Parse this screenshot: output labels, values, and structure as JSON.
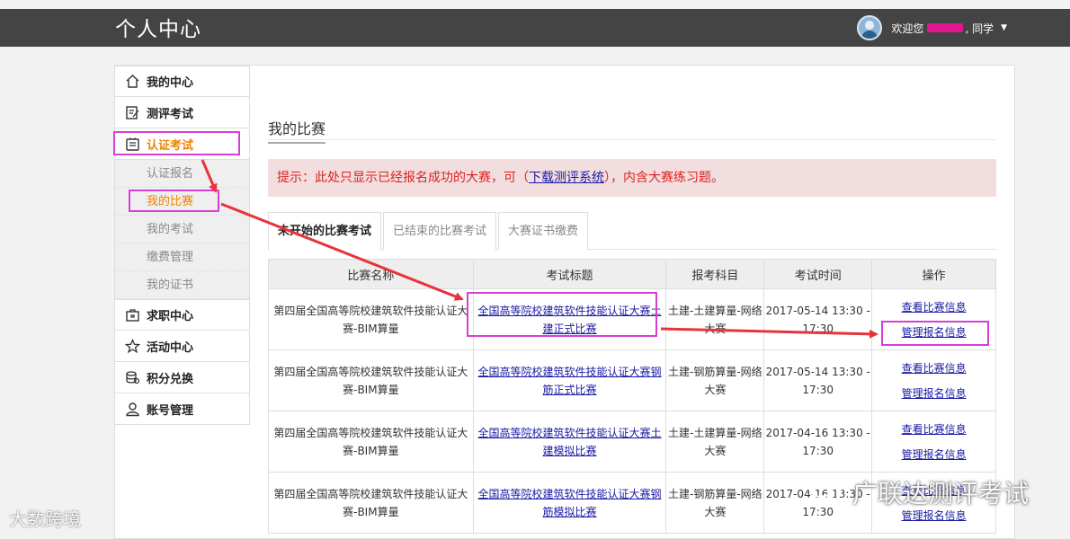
{
  "header": {
    "app_title": "个人中心",
    "welcome_prefix": "欢迎您",
    "welcome_suffix": ", 同学"
  },
  "sidebar": {
    "items": [
      {
        "label": "我的中心",
        "icon": "home-icon"
      },
      {
        "label": "测评考试",
        "icon": "document-edit-icon"
      },
      {
        "label": "认证考试",
        "icon": "certificate-icon"
      },
      {
        "label": "求职中心",
        "icon": "briefcase-icon"
      },
      {
        "label": "活动中心",
        "icon": "star-icon"
      },
      {
        "label": "积分兑换",
        "icon": "coins-icon"
      },
      {
        "label": "账号管理",
        "icon": "user-icon"
      }
    ],
    "sub_items": [
      "认证报名",
      "我的比赛",
      "我的考试",
      "缴费管理",
      "我的证书"
    ]
  },
  "main": {
    "section_title": "我的比赛",
    "notice_prefix": "提示：此处只显示已经报名成功的大赛，可（",
    "notice_link": "下载测评系统",
    "notice_suffix": "），内含大赛练习题。",
    "tabs": [
      "未开始的比赛考试",
      "已结束的比赛考试",
      "大赛证书缴费"
    ],
    "table": {
      "headers": [
        "比赛名称",
        "考试标题",
        "报考科目",
        "考试时间",
        "操作"
      ],
      "rows": [
        {
          "name": "第四届全国高等院校建筑软件技能认证大赛-BIM算量",
          "title": "全国高等院校建筑软件技能认证大赛土建正式比赛",
          "subject": "土建-土建算量-网络大赛",
          "time": "2017-05-14 13:30 - 17:30",
          "op1": "查看比赛信息",
          "op2": "管理报名信息"
        },
        {
          "name": "第四届全国高等院校建筑软件技能认证大赛-BIM算量",
          "title": "全国高等院校建筑软件技能认证大赛钢筋正式比赛",
          "subject": "土建-钢筋算量-网络大赛",
          "time": "2017-05-14 13:30 - 17:30",
          "op1": "查看比赛信息",
          "op2": "管理报名信息"
        },
        {
          "name": "第四届全国高等院校建筑软件技能认证大赛-BIM算量",
          "title": "全国高等院校建筑软件技能认证大赛土建模拟比赛",
          "subject": "土建-土建算量-网络大赛",
          "time": "2017-04-16 13:30 - 17:30",
          "op1": "查看比赛信息",
          "op2": "管理报名信息"
        },
        {
          "name": "第四届全国高等院校建筑软件技能认证大赛-BIM算量",
          "title": "全国高等院校建筑软件技能认证大赛钢筋模拟比赛",
          "subject": "土建-钢筋算量-网络大赛",
          "time": "2017-04-16 13:30 - 17:30",
          "op1": "查看比赛信息",
          "op2": "管理报名信息"
        }
      ]
    }
  },
  "watermarks": {
    "right": "广联达测评考试",
    "left": "大数跨境"
  },
  "colors": {
    "accent": "#f08300",
    "highlight": "#d63fd6",
    "arrow": "#e8333a",
    "header_bg": "#444444",
    "notice_bg": "#f2dede"
  }
}
